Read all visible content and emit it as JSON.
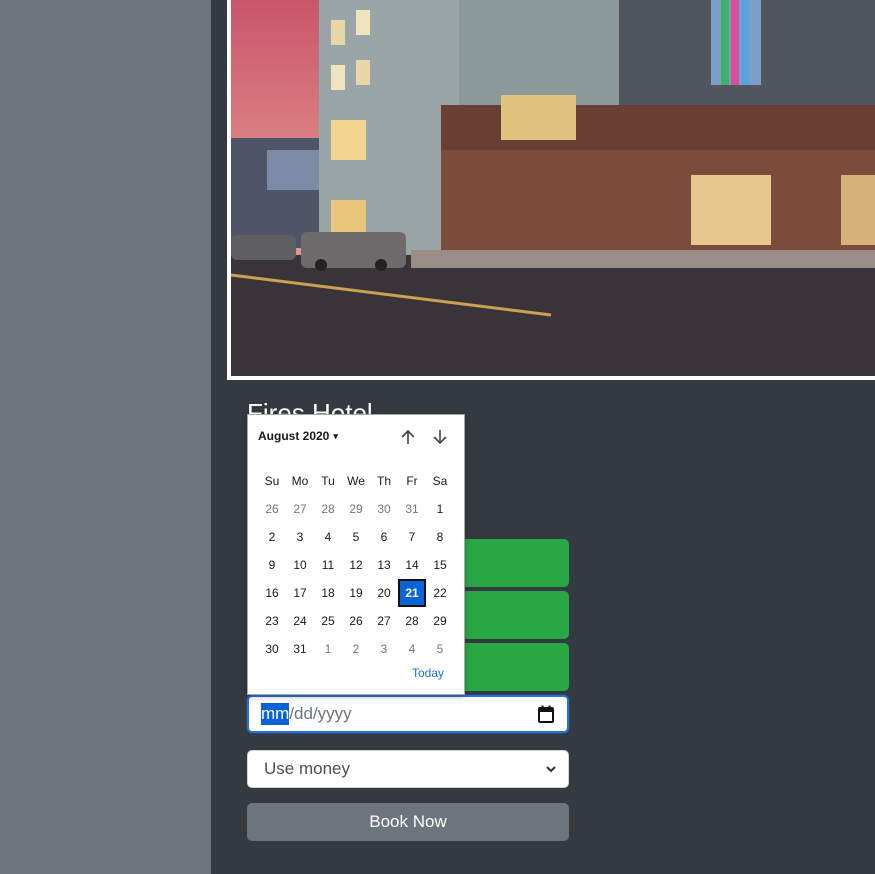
{
  "hotel": {
    "title": "Fires Hotel"
  },
  "date_input": {
    "month_seg": "mm",
    "rest": "/dd/yyyy"
  },
  "payment_select": {
    "selected": "Use money"
  },
  "book_button": {
    "label": "Book Now"
  },
  "date_picker": {
    "month_label": "August 2020",
    "weekdays": [
      "Su",
      "Mo",
      "Tu",
      "We",
      "Th",
      "Fr",
      "Sa"
    ],
    "weeks": [
      [
        {
          "d": "26",
          "other": true
        },
        {
          "d": "27",
          "other": true
        },
        {
          "d": "28",
          "other": true
        },
        {
          "d": "29",
          "other": true
        },
        {
          "d": "30",
          "other": true
        },
        {
          "d": "31",
          "other": true
        },
        {
          "d": "1"
        }
      ],
      [
        {
          "d": "2"
        },
        {
          "d": "3"
        },
        {
          "d": "4"
        },
        {
          "d": "5"
        },
        {
          "d": "6"
        },
        {
          "d": "7"
        },
        {
          "d": "8"
        }
      ],
      [
        {
          "d": "9"
        },
        {
          "d": "10"
        },
        {
          "d": "11"
        },
        {
          "d": "12"
        },
        {
          "d": "13"
        },
        {
          "d": "14"
        },
        {
          "d": "15"
        }
      ],
      [
        {
          "d": "16"
        },
        {
          "d": "17"
        },
        {
          "d": "18"
        },
        {
          "d": "19"
        },
        {
          "d": "20"
        },
        {
          "d": "21",
          "selected": true
        },
        {
          "d": "22"
        }
      ],
      [
        {
          "d": "23"
        },
        {
          "d": "24"
        },
        {
          "d": "25"
        },
        {
          "d": "26"
        },
        {
          "d": "27"
        },
        {
          "d": "28"
        },
        {
          "d": "29"
        }
      ],
      [
        {
          "d": "30"
        },
        {
          "d": "31"
        },
        {
          "d": "1",
          "other": true
        },
        {
          "d": "2",
          "other": true
        },
        {
          "d": "3",
          "other": true
        },
        {
          "d": "4",
          "other": true
        },
        {
          "d": "5",
          "other": true
        }
      ]
    ],
    "today_label": "Today"
  },
  "colors": {
    "sidebar": "#6c757d",
    "main_bg": "#343a40",
    "success": "#28a745",
    "accent": "#0a64d8",
    "secondary_button": "#6c757d"
  },
  "icons": {
    "calendar": "calendar-icon",
    "nav_up": "arrow-up-icon",
    "nav_down": "arrow-down-icon",
    "select_chevron": "chevron-down-icon"
  }
}
